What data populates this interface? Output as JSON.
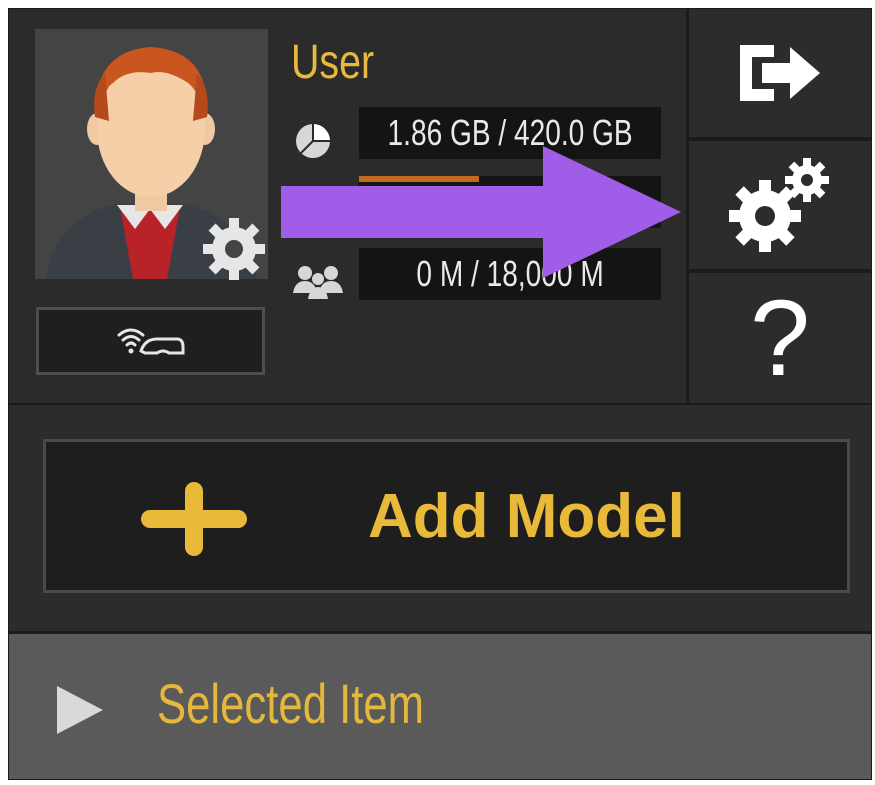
{
  "user": {
    "name": "User"
  },
  "stats": {
    "storage": "1.86 GB / 420.0 GB",
    "second": "",
    "members": "0 M / 18,000 M"
  },
  "actions": {
    "add_model_label": "Add Model"
  },
  "selected": {
    "label": "Selected Item"
  },
  "icons": {
    "logout": "logout-icon",
    "settings": "settings-gears-icon",
    "help": "?",
    "wifi": "wifi-headset-icon"
  },
  "colors": {
    "accent": "#e8b93c",
    "overlay_arrow": "#a05ee8"
  }
}
